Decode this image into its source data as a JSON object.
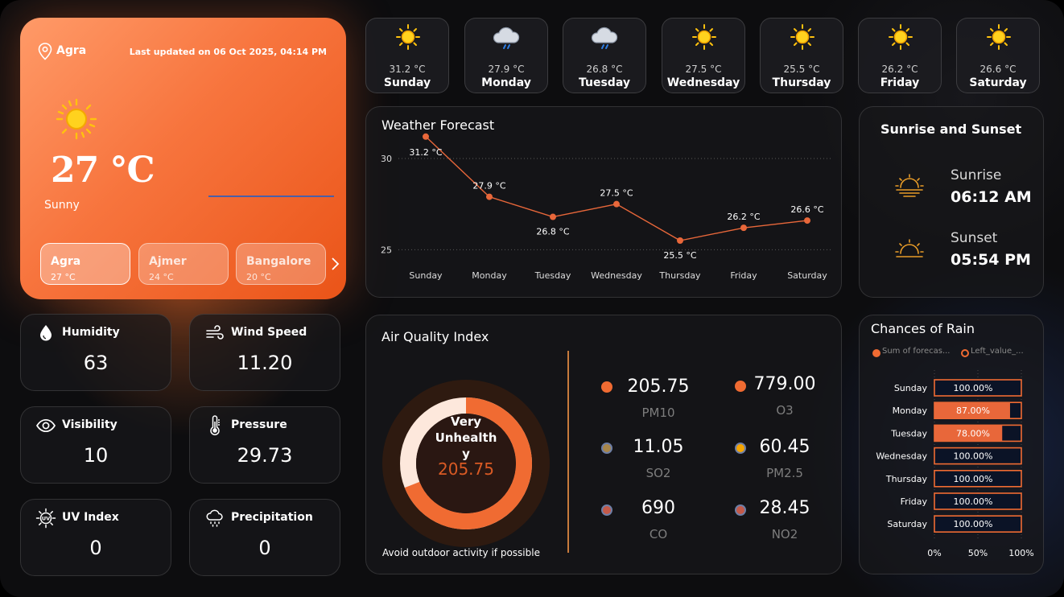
{
  "colors": {
    "accent": "#f06b32",
    "hero_start": "#ff9a68",
    "hero_end": "#ea5418",
    "sun": "#ffc20e",
    "so2_dot": "#a8864a",
    "pm25_dot": "#f5a500",
    "co_dot": "#c45a4a"
  },
  "hero": {
    "location_icon": "map-pin-icon",
    "city": "Agra",
    "last_updated": "Last updated on 06 Oct 2025, 04:14 PM",
    "weather_icon": "sun-icon",
    "temperature": "27 °C",
    "condition": "Sunny",
    "cities": [
      {
        "name": "Agra",
        "temp": "27 °C"
      },
      {
        "name": "Ajmer",
        "temp": "24 °C"
      },
      {
        "name": "Bangalore",
        "temp": "20 °C"
      }
    ],
    "next_icon": "chevron-right-icon"
  },
  "week": [
    {
      "day": "Sunday",
      "temp": "31.2 °C",
      "icon": "sun-icon"
    },
    {
      "day": "Monday",
      "temp": "27.9 °C",
      "icon": "rain-cloud-icon"
    },
    {
      "day": "Tuesday",
      "temp": "26.8 °C",
      "icon": "rain-cloud-icon"
    },
    {
      "day": "Wednesday",
      "temp": "27.5 °C",
      "icon": "sun-icon"
    },
    {
      "day": "Thursday",
      "temp": "25.5 °C",
      "icon": "sun-icon"
    },
    {
      "day": "Friday",
      "temp": "26.2 °C",
      "icon": "sun-icon"
    },
    {
      "day": "Saturday",
      "temp": "26.6 °C",
      "icon": "sun-icon"
    }
  ],
  "stats": [
    {
      "label": "Humidity",
      "value": "63",
      "icon": "droplet-icon"
    },
    {
      "label": "Wind Speed",
      "value": "11.20",
      "icon": "wind-icon"
    },
    {
      "label": "Visibility",
      "value": "10",
      "icon": "eye-icon"
    },
    {
      "label": "Pressure",
      "value": "29.73",
      "icon": "thermometer-icon"
    },
    {
      "label": "UV Index",
      "value": "0",
      "icon": "uv-sun-icon"
    },
    {
      "label": "Precipitation",
      "value": "0",
      "icon": "cloud-rain-icon"
    }
  ],
  "forecast": {
    "title": "Weather Forecast"
  },
  "sun": {
    "title": "Sunrise and Sunset",
    "sunrise_label": "Sunrise",
    "sunrise_time": "06:12 AM",
    "sunset_label": "Sunset",
    "sunset_time": "05:54 PM"
  },
  "aqi": {
    "title": "Air Quality Index",
    "value": "205.75",
    "value_fraction": 0.69,
    "status_lines": [
      "Very",
      "Unhealth",
      "y"
    ],
    "advice": "Avoid outdoor activity if possible",
    "pollutants": [
      {
        "name": "PM10",
        "value": "205.75"
      },
      {
        "name": "O3",
        "value": "779.00"
      },
      {
        "name": "SO2",
        "value": "11.05"
      },
      {
        "name": "PM2.5",
        "value": "60.45"
      },
      {
        "name": "CO",
        "value": "690"
      },
      {
        "name": "NO2",
        "value": "28.45"
      }
    ]
  },
  "rain": {
    "title": "Chances of Rain",
    "legend": [
      "Sum of forecas...",
      "Left_value_..."
    ]
  },
  "chart_data": [
    {
      "type": "line",
      "title": "Weather Forecast",
      "categories": [
        "Sunday",
        "Monday",
        "Tuesday",
        "Wednesday",
        "Thursday",
        "Friday",
        "Saturday"
      ],
      "series": [
        {
          "values": [
            31.2,
            27.9,
            26.8,
            27.5,
            25.5,
            26.2,
            26.6
          ]
        }
      ],
      "data_labels": [
        "31.2 °C",
        "27.9 °C",
        "26.8 °C",
        "27.5 °C",
        "25.5 °C",
        "26.2 °C",
        "26.6 °C"
      ],
      "yticks": [
        "25",
        "30"
      ],
      "ylim": [
        24.0,
        31.5
      ],
      "grid": true
    },
    {
      "type": "bar",
      "title": "Chances of Rain",
      "orientation": "horizontal",
      "categories": [
        "Sunday",
        "Monday",
        "Tuesday",
        "Wednesday",
        "Thursday",
        "Friday",
        "Saturday"
      ],
      "series": [
        {
          "name": "Sum of forecas...",
          "values": [
            100,
            87,
            78,
            100,
            100,
            100,
            100
          ]
        },
        {
          "name": "Left_value_...",
          "values": [
            0,
            13,
            22,
            0,
            0,
            0,
            0
          ]
        }
      ],
      "data_labels": [
        "100.00%",
        "87.00%",
        "78.00%",
        "100.00%",
        "100.00%",
        "100.00%",
        "100.00%"
      ],
      "xticks": [
        "0%",
        "50%",
        "100%"
      ],
      "xlim": [
        0,
        100
      ],
      "legend": "top-left"
    }
  ]
}
